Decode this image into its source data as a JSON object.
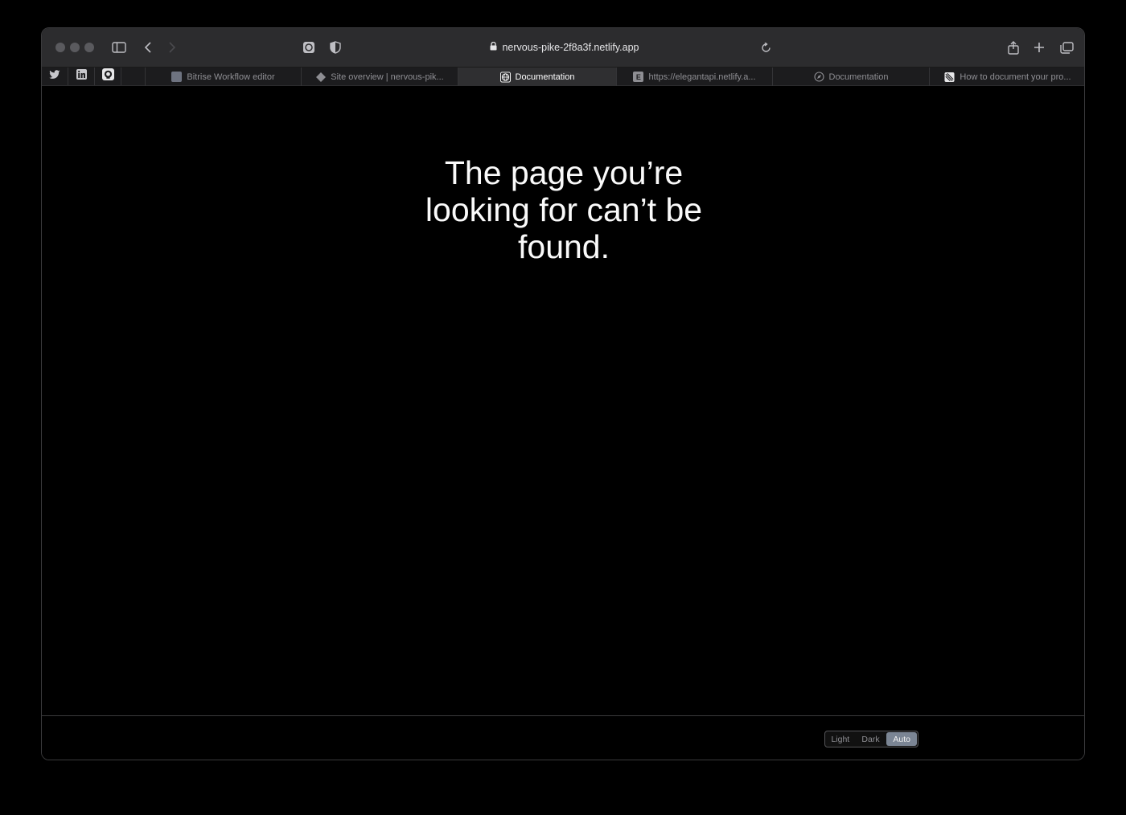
{
  "browser": {
    "address": "nervous-pike-2f8a3f.netlify.app",
    "favorites": [
      {
        "icon": "twitter-icon"
      },
      {
        "icon": "linkedin-icon"
      },
      {
        "icon": "github-icon"
      }
    ],
    "tabs": [
      {
        "label": "Bitrise Workflow editor",
        "icon": "bitrise-icon",
        "active": false
      },
      {
        "label": "Site overview | nervous-pik...",
        "icon": "netlify-icon",
        "active": false
      },
      {
        "label": "Documentation",
        "icon": "globe-icon",
        "active": true
      },
      {
        "label": "https://elegantapi.netlify.a...",
        "icon": "e-letter-icon",
        "icon_text": "E",
        "active": false
      },
      {
        "label": "Documentation",
        "icon": "compass-icon",
        "active": false
      },
      {
        "label": "How to document your pro...",
        "icon": "stripes-icon",
        "active": false
      }
    ]
  },
  "page": {
    "message": "The page you’re looking for can’t be found."
  },
  "footer": {
    "theme": {
      "options": [
        "Light",
        "Dark",
        "Auto"
      ],
      "selected": "Auto"
    }
  },
  "colors": {
    "toolbar": "#2c2c2e",
    "tabbar": "#1c1c1e",
    "background": "#000000",
    "selected_theme": "#7b8594"
  }
}
